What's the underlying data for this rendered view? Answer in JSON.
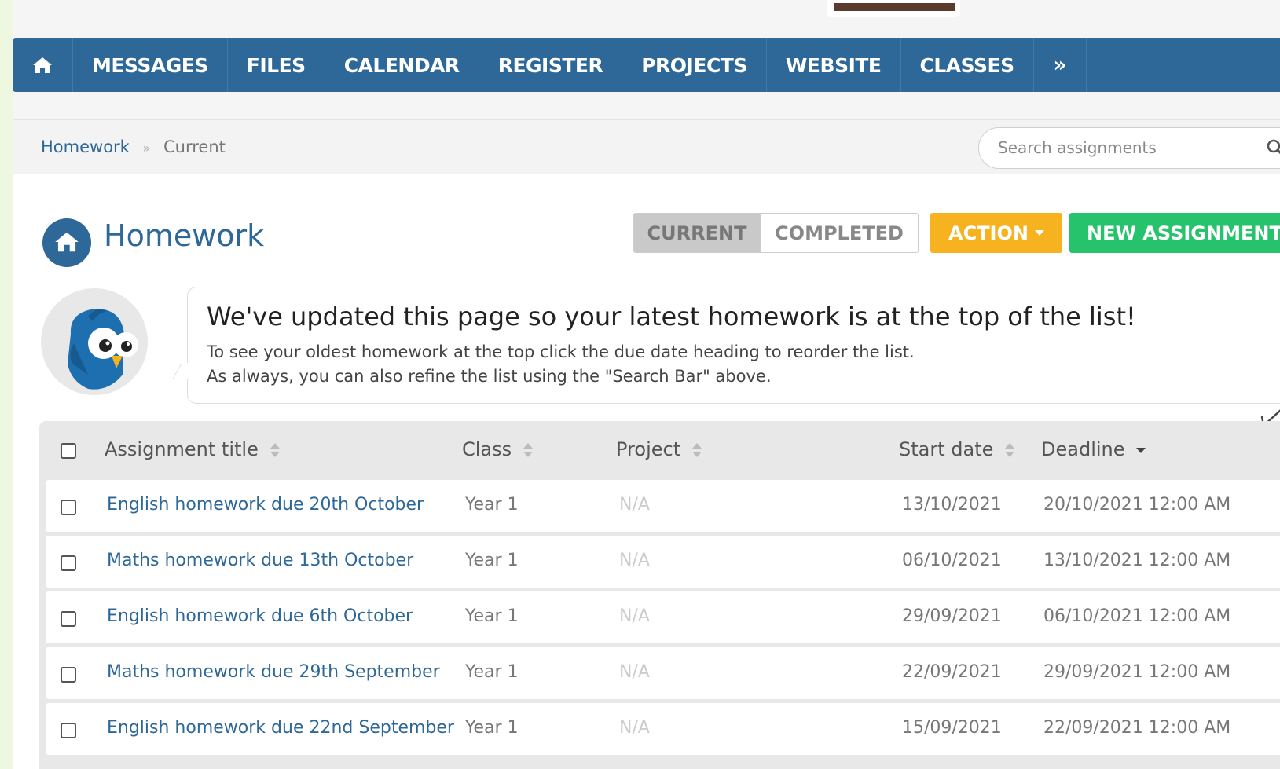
{
  "nav": {
    "home_icon": "home-icon",
    "items": [
      "MESSAGES",
      "FILES",
      "CALENDAR",
      "REGISTER",
      "PROJECTS",
      "WEBSITE",
      "CLASSES"
    ],
    "more": "»"
  },
  "breadcrumb": {
    "parent": "Homework",
    "separator": "»",
    "current": "Current"
  },
  "search": {
    "placeholder": "Search assignments",
    "icon": "search-icon"
  },
  "header": {
    "title": "Homework",
    "tabs": {
      "current": "CURRENT",
      "completed": "COMPLETED"
    },
    "action_label": "ACTION",
    "new_label": "NEW ASSIGNMENT"
  },
  "notice": {
    "headline": "We've updated this page so your latest homework is at the top of the list!",
    "line1": "To see your oldest homework at the top click the due date heading to reorder the list.",
    "line2": "As always, you can also refine the list using the \"Search Bar\" above."
  },
  "table": {
    "columns": {
      "title": "Assignment title",
      "class": "Class",
      "project": "Project",
      "start": "Start date",
      "deadline": "Deadline"
    },
    "rows": [
      {
        "title": "English homework due 20th October",
        "class": "Year 1",
        "project": "N/A",
        "start": "13/10/2021",
        "deadline": "20/10/2021 12:00 AM"
      },
      {
        "title": "Maths homework due 13th October",
        "class": "Year 1",
        "project": "N/A",
        "start": "06/10/2021",
        "deadline": "13/10/2021 12:00 AM"
      },
      {
        "title": "English homework due 6th October",
        "class": "Year 1",
        "project": "N/A",
        "start": "29/09/2021",
        "deadline": "06/10/2021 12:00 AM"
      },
      {
        "title": "Maths homework due 29th September",
        "class": "Year 1",
        "project": "N/A",
        "start": "22/09/2021",
        "deadline": "29/09/2021 12:00 AM"
      },
      {
        "title": "English homework due 22nd September",
        "class": "Year 1",
        "project": "N/A",
        "start": "15/09/2021",
        "deadline": "22/09/2021 12:00 AM"
      }
    ]
  },
  "colors": {
    "nav": "#2e6899",
    "action": "#f7b21f",
    "new": "#27c26c",
    "link": "#2e6899"
  }
}
